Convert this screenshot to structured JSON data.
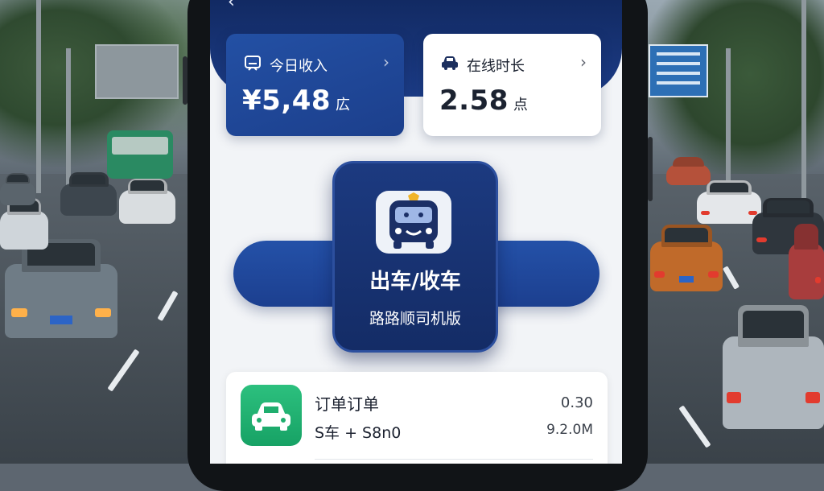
{
  "header": {
    "back_glyph": "‹"
  },
  "cards": {
    "income": {
      "icon": "wallet-icon",
      "title": "今日收入",
      "value": "¥5,48",
      "unit": "広",
      "chevron": "›"
    },
    "online": {
      "icon": "car-icon",
      "title": "在线时长",
      "value": "2.58",
      "unit": "点",
      "chevron": "›"
    }
  },
  "main_button": {
    "icon": "robot-bus-icon",
    "title": "出车/收车",
    "subtitle": "路路顺司机版"
  },
  "order": {
    "icon": "car-icon",
    "title": "订单订单",
    "subtitle": "S车 + S8n0",
    "right_top": "0.30",
    "right_bottom": "9.2.0M"
  },
  "colors": {
    "header": "#122a63",
    "accent": "#2350a4",
    "order_icon": "#1fae6e"
  }
}
